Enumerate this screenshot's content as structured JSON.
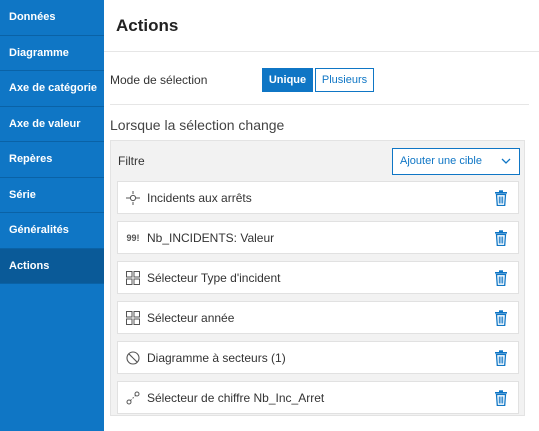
{
  "sidebar": {
    "items": [
      {
        "label": "Données"
      },
      {
        "label": "Diagramme"
      },
      {
        "label": "Axe de catégorie"
      },
      {
        "label": "Axe de valeur"
      },
      {
        "label": "Repères"
      },
      {
        "label": "Série"
      },
      {
        "label": "Généralités"
      },
      {
        "label": "Actions",
        "active": true
      }
    ]
  },
  "panel": {
    "title": "Actions",
    "selection_mode": {
      "label": "Mode de sélection",
      "options": [
        "Unique",
        "Plusieurs"
      ],
      "selected": "Unique"
    },
    "section_title": "Lorsque la sélection change",
    "filter": {
      "label": "Filtre",
      "add_target_label": "Ajouter une cible",
      "items": [
        {
          "label": "Incidents aux arrêts",
          "icon": "map-point-icon"
        },
        {
          "label": "Nb_INCIDENTS: Valeur",
          "icon": "number-99-icon"
        },
        {
          "label": "Sélecteur Type d'incident",
          "icon": "grid-selector-icon"
        },
        {
          "label": "Sélecteur année",
          "icon": "grid-selector-icon"
        },
        {
          "label": "Diagramme à secteurs (1)",
          "icon": "pie-chart-icon"
        },
        {
          "label": "Sélecteur de chiffre Nb_Inc_Arret",
          "icon": "number-selector-icon"
        }
      ]
    }
  },
  "colors": {
    "accent": "#0f76c5",
    "sidebar_active": "#0a5a98",
    "trash": "#0f76c5"
  }
}
